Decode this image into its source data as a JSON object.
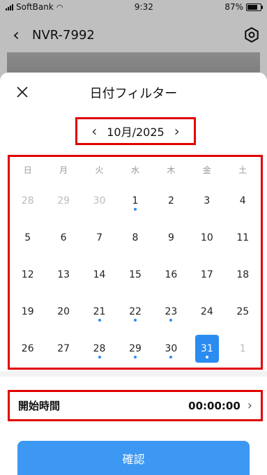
{
  "status_bar": {
    "carrier": "SoftBank",
    "time": "9:32",
    "battery": "87%",
    "battery_level": 0.87
  },
  "header": {
    "title": "NVR-7992"
  },
  "sheet": {
    "title": "日付フィルター",
    "month_label": "10月/2025",
    "weekdays": [
      "日",
      "月",
      "火",
      "水",
      "木",
      "金",
      "土"
    ],
    "weeks": [
      [
        {
          "d": "28",
          "m": true
        },
        {
          "d": "29",
          "m": true
        },
        {
          "d": "30",
          "m": true
        },
        {
          "d": "1",
          "dot": true
        },
        {
          "d": "2"
        },
        {
          "d": "3"
        },
        {
          "d": "4"
        }
      ],
      [
        {
          "d": "5"
        },
        {
          "d": "6"
        },
        {
          "d": "7"
        },
        {
          "d": "8"
        },
        {
          "d": "9"
        },
        {
          "d": "10"
        },
        {
          "d": "11"
        }
      ],
      [
        {
          "d": "12"
        },
        {
          "d": "13"
        },
        {
          "d": "14"
        },
        {
          "d": "15"
        },
        {
          "d": "16"
        },
        {
          "d": "17"
        },
        {
          "d": "18"
        }
      ],
      [
        {
          "d": "19"
        },
        {
          "d": "20"
        },
        {
          "d": "21",
          "dot": true
        },
        {
          "d": "22",
          "dot": true
        },
        {
          "d": "23",
          "dot": true
        },
        {
          "d": "24"
        },
        {
          "d": "25"
        }
      ],
      [
        {
          "d": "26"
        },
        {
          "d": "27"
        },
        {
          "d": "28",
          "dot": true
        },
        {
          "d": "29",
          "dot": true
        },
        {
          "d": "30",
          "dot": true
        },
        {
          "d": "31",
          "dot": true,
          "sel": true
        },
        {
          "d": "1",
          "m": true
        }
      ]
    ],
    "start_time_label": "開始時間",
    "start_time_value": "00:00:00",
    "confirm_label": "確認"
  },
  "colors": {
    "accent": "#2a8cf0",
    "highlight_border": "#e10000"
  }
}
